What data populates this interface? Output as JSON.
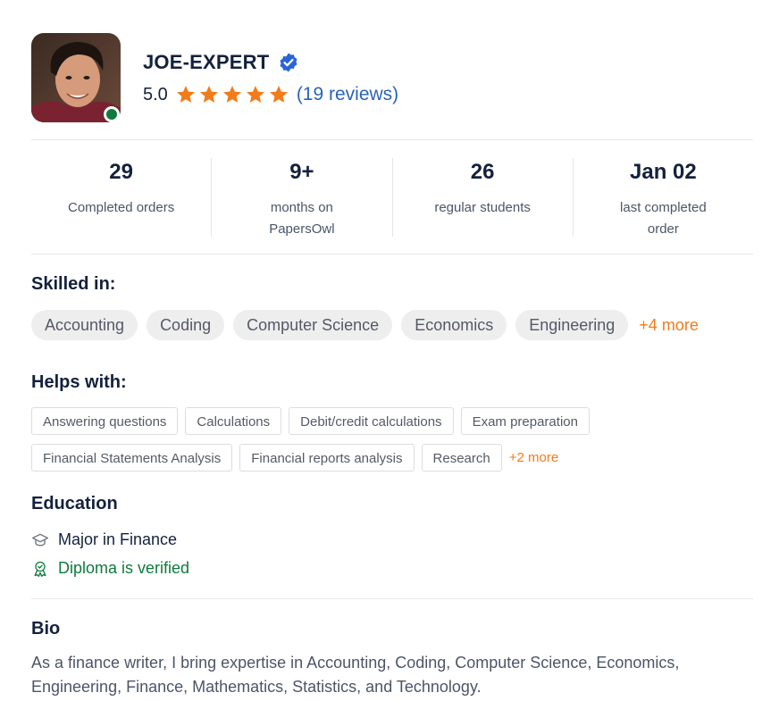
{
  "profile": {
    "name": "JOE-EXPERT",
    "rating": "5.0",
    "stars": 5,
    "reviews": "(19 reviews)"
  },
  "stats": [
    {
      "value": "29",
      "label": "Completed orders"
    },
    {
      "value": "9+",
      "label": "months on PapersOwl"
    },
    {
      "value": "26",
      "label": "regular students"
    },
    {
      "value": "Jan 02",
      "label": "last completed order"
    }
  ],
  "skilled": {
    "title": "Skilled in:",
    "items": [
      "Accounting",
      "Coding",
      "Computer Science",
      "Economics",
      "Engineering"
    ],
    "more": "+4 more"
  },
  "helps": {
    "title": "Helps with:",
    "row1": [
      "Answering questions",
      "Calculations",
      "Debit/credit calculations",
      "Exam preparation"
    ],
    "row2": [
      "Financial Statements Analysis",
      "Financial reports analysis",
      "Research"
    ],
    "more": "+2 more"
  },
  "education": {
    "title": "Education",
    "major": "Major in Finance",
    "verified": "Diploma is verified"
  },
  "bio": {
    "title": "Bio",
    "text": "As a finance writer, I bring expertise in Accounting, Coding, Computer Science, Economics, Engineering, Finance, Mathematics, Statistics, and Technology."
  },
  "colors": {
    "accent_orange": "#f27b1a",
    "link_blue": "#2b63b8",
    "verified_green": "#0f7a3d",
    "dark_navy": "#14213d"
  },
  "icons": [
    "verified-badge-icon",
    "star-icon",
    "graduation-cap-icon",
    "award-ribbon-icon"
  ]
}
